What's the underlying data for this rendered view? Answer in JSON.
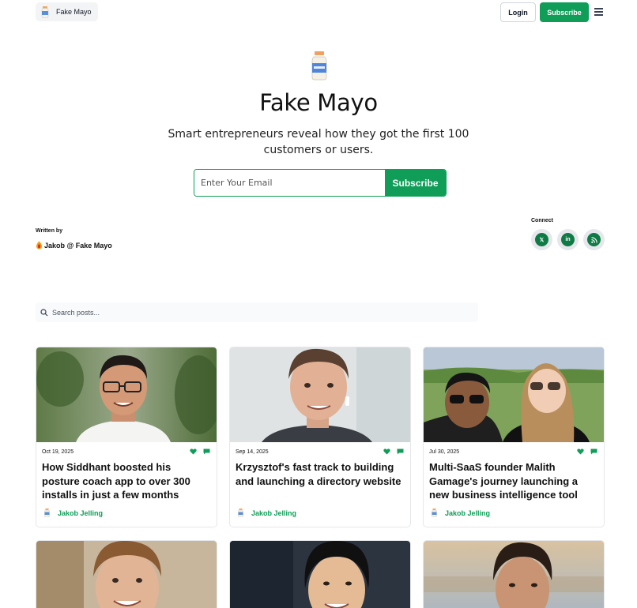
{
  "header": {
    "brand_name": "Fake Mayo",
    "login_label": "Login",
    "subscribe_label": "Subscribe"
  },
  "hero": {
    "title": "Fake Mayo",
    "description": "Smart entrepreneurs reveal how they got the first 100 customers or users.",
    "email_placeholder": "Enter Your Email",
    "subscribe_label": "Subscribe"
  },
  "author": {
    "written_by_label": "Written by",
    "name": "Jakob @ Fake Mayo"
  },
  "connect": {
    "label": "Connect",
    "links": [
      "x-icon",
      "linkedin-icon",
      "rss-icon"
    ]
  },
  "search": {
    "placeholder": "Search posts..."
  },
  "posts": [
    {
      "date": "Oct 19, 2025",
      "title": "How Siddhant boosted his posture coach app to over 300 installs in just a few months",
      "author": "Jakob Jelling"
    },
    {
      "date": "Sep 14, 2025",
      "title": "Krzysztof's fast track to building and launching a directory website",
      "author": "Jakob Jelling"
    },
    {
      "date": "Jul 30, 2025",
      "title": "Multi-SaaS founder Malith Gamage's journey launching a new business intelligence tool",
      "author": "Jakob Jelling"
    }
  ],
  "colors": {
    "accent": "#0f9d58",
    "accent_dark": "#0f7a45"
  }
}
